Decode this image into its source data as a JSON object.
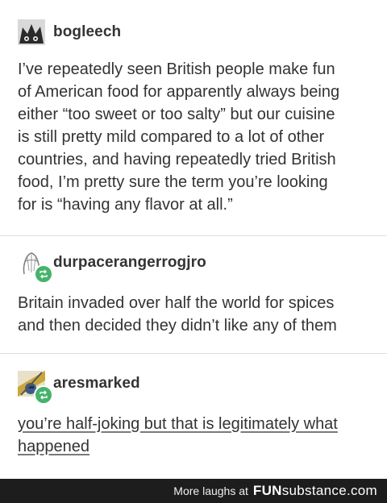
{
  "posts": [
    {
      "username": "bogleech",
      "avatar_icon": "monster-avatar-icon",
      "lines": [
        "I’ve repeatedly seen British people make fun",
        "of American food for apparently always being",
        "either “too sweet or too salty” but our cuisine",
        "is still pretty mild compared to a lot of other",
        "countries, and having repeatedly tried British",
        "food, I’m pretty sure the term you’re looking",
        "for is “having any flavor at all.”"
      ]
    },
    {
      "username": "durpacerangerrogjro",
      "avatar_icon": "sketch-avatar-icon",
      "badge_icon": "reblog-icon",
      "lines": [
        "Britain invaded over half the world for spices",
        "and then decided they didn’t like any of them"
      ]
    },
    {
      "username": "aresmarked",
      "avatar_icon": "knight-avatar-icon",
      "badge_icon": "reblog-icon",
      "lines": [
        "you’re half-joking but that is legitimately what",
        "happened"
      ]
    }
  ],
  "footer": {
    "text": "More laughs at",
    "brand_bold": "FUN",
    "brand_rest": "substance.com"
  },
  "colors": {
    "reblog_badge": "#46b36b",
    "footer_bg": "#1d1d1d",
    "text": "#333333"
  }
}
